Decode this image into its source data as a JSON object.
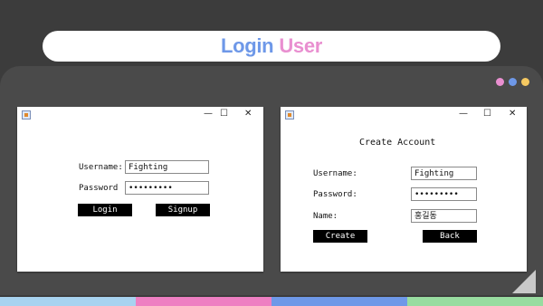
{
  "header": {
    "title_part1": "Login",
    "title_part2": "User"
  },
  "window_dots": [
    "#e98fd0",
    "#6e98e8",
    "#f5c861"
  ],
  "window_controls": {
    "minimize": "—",
    "maximize": "☐",
    "close": "✕"
  },
  "login_window": {
    "username_label": "Username:",
    "username_value": "Fighting",
    "password_label": "Password",
    "password_value": "•••••••••",
    "login_button": "Login",
    "signup_button": "Signup"
  },
  "create_window": {
    "heading": "Create Account",
    "username_label": "Username:",
    "username_value": "Fighting",
    "password_label": "Password:",
    "password_value": "•••••••••",
    "name_label": "Name:",
    "name_value": "홍길동",
    "create_button": "Create",
    "back_button": "Back"
  },
  "stripe_colors": [
    "#a8d3f0",
    "#ee7fc2",
    "#6e98e8",
    "#98dca0"
  ]
}
